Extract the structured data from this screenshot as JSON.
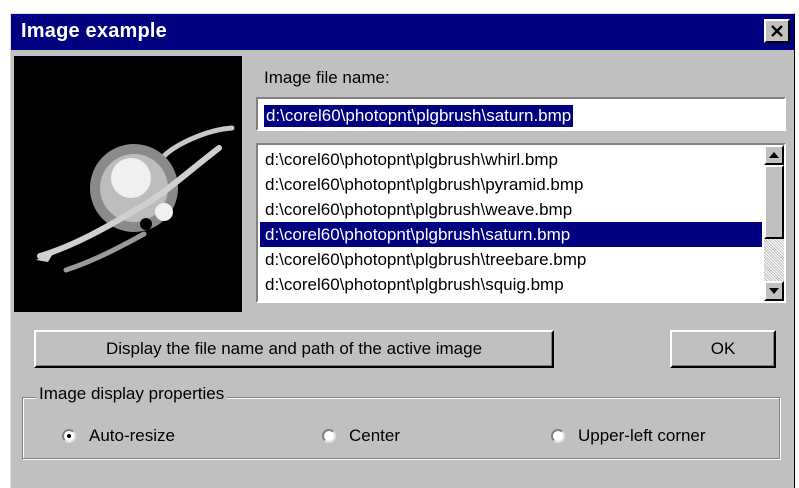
{
  "window": {
    "title": "Image example",
    "close_glyph": "✕"
  },
  "preview": {
    "icon": "saturn-icon"
  },
  "file_name": {
    "label": "Image file name:",
    "value": "d:\\corel60\\photopnt\\plgbrush\\saturn.bmp"
  },
  "file_list": {
    "items": [
      "d:\\corel60\\photopnt\\plgbrush\\whirl.bmp",
      "d:\\corel60\\photopnt\\plgbrush\\pyramid.bmp",
      "d:\\corel60\\photopnt\\plgbrush\\weave.bmp",
      "d:\\corel60\\photopnt\\plgbrush\\saturn.bmp",
      "d:\\corel60\\photopnt\\plgbrush\\treebare.bmp",
      "d:\\corel60\\photopnt\\plgbrush\\squig.bmp"
    ],
    "selected": "d:\\corel60\\photopnt\\plgbrush\\saturn.bmp"
  },
  "buttons": {
    "display_path": "Display the file name and path of the active image",
    "ok": "OK"
  },
  "display_properties": {
    "legend": "Image display properties",
    "options": [
      "Auto-resize",
      "Center",
      "Upper-left corner"
    ],
    "selected": "Auto-resize"
  },
  "colors": {
    "title_bar": "#000080",
    "face": "#c0c0c0",
    "selection": "#000080"
  }
}
